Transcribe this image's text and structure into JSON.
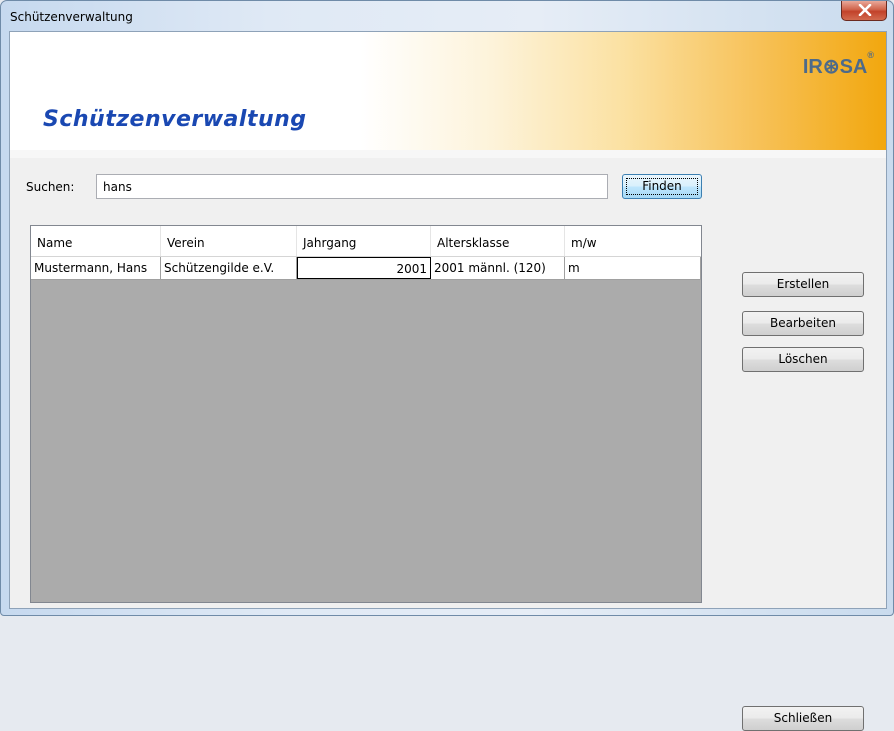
{
  "window": {
    "title": "Schützenverwaltung"
  },
  "banner": {
    "title": "Schützenverwaltung",
    "logo": "IR⊛SA",
    "logo_mark": "®"
  },
  "search": {
    "label": "Suchen:",
    "value": "hans",
    "button": "Finden"
  },
  "table": {
    "columns": [
      "Name",
      "Verein",
      "Jahrgang",
      "Altersklasse",
      "m/w"
    ],
    "rows": [
      [
        "Mustermann, Hans",
        "Schützengilde e.V.",
        "2001",
        "2001 männl. (120)",
        "m"
      ]
    ]
  },
  "actions": {
    "create": "Erstellen",
    "edit": "Bearbeiten",
    "delete": "Löschen",
    "close": "Schließen"
  }
}
